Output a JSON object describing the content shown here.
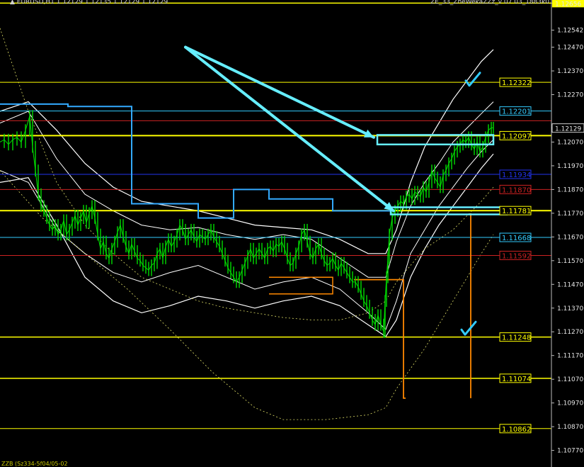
{
  "window": {
    "header_left": "▲ EURUSD,H1 1.12129 1.12135 1.12129 1.12129",
    "header_right": "ZE_33_ZheWekaZZz_v 07 03_1883k0",
    "footer_left": "ZZB (Sz334-5f04/05-02"
  },
  "colors": {
    "background": "#000000",
    "yellow_level": "#ffff00",
    "cyan_level": "#33ccff",
    "red_level": "#cc2222",
    "blue_level": "#2233ee",
    "candle_green": "#00dd00",
    "band_white": "#ffffff",
    "orange": "#ff8800",
    "arrow_cyan": "#66eeff",
    "checkmark": "#33ccff"
  },
  "chart_data": {
    "type": "line",
    "instrument": "EURUSD",
    "timeframe": "H1",
    "ylim": [
      1.107,
      1.1266
    ],
    "y_ticks": [
      "1.12656",
      "1.12542",
      "1.12470",
      "1.12370",
      "1.12270",
      "1.12129",
      "1.12070",
      "1.11970",
      "1.11870",
      "1.11770",
      "1.11670",
      "1.11570",
      "1.11470",
      "1.11370",
      "1.11270",
      "1.11170",
      "1.11070",
      "1.10970",
      "1.10870",
      "1.10770"
    ],
    "current_price": "1.12129",
    "price_levels": [
      {
        "name": "resistance-1",
        "value": 1.12322,
        "label": "1.12322",
        "color": "#ffff00",
        "style": "thin"
      },
      {
        "name": "resistance-2",
        "value": 1.12201,
        "label": "1.12201",
        "color": "#33ccff",
        "style": "thin"
      },
      {
        "name": "level-red-1",
        "value": 1.1216,
        "label": "",
        "color": "#cc2222",
        "style": "thin"
      },
      {
        "name": "level-yellow-main",
        "value": 1.12097,
        "label": "1.12097",
        "color": "#ffff00",
        "style": "thick"
      },
      {
        "name": "level-blue",
        "value": 1.11934,
        "label": "1.11934",
        "color": "#2233ee",
        "style": "thin"
      },
      {
        "name": "level-red-2",
        "value": 1.1187,
        "label": "1.11870",
        "color": "#cc2222",
        "style": "thin"
      },
      {
        "name": "level-yellow-2",
        "value": 1.11781,
        "label": "1.11781",
        "color": "#ffff00",
        "style": "thick"
      },
      {
        "name": "level-cyan-2",
        "value": 1.11668,
        "label": "1.11668",
        "color": "#33ccff",
        "style": "thin"
      },
      {
        "name": "level-red-3",
        "value": 1.11592,
        "label": "1.11592",
        "color": "#cc2222",
        "style": "thin"
      },
      {
        "name": "level-yellow-3",
        "value": 1.11248,
        "label": "1.11248",
        "color": "#ffff00",
        "style": "medium"
      },
      {
        "name": "level-yellow-4",
        "value": 1.11074,
        "label": "1.11074",
        "color": "#ffff00",
        "style": "medium"
      },
      {
        "name": "level-yellow-5",
        "value": 1.10862,
        "label": "1.10862",
        "color": "#ffff00",
        "style": "thin"
      }
    ],
    "top_level": {
      "value": 1.12656,
      "label": "1.12656"
    },
    "price_series": [
      [
        0,
        1.1207
      ],
      [
        6,
        1.1208
      ],
      [
        12,
        1.1206
      ],
      [
        18,
        1.1208
      ],
      [
        24,
        1.1209
      ],
      [
        30,
        1.1207
      ],
      [
        36,
        1.1212
      ],
      [
        42,
        1.1218
      ],
      [
        46,
        1.1205
      ],
      [
        50,
        1.1195
      ],
      [
        54,
        1.1185
      ],
      [
        58,
        1.118
      ],
      [
        62,
        1.1178
      ],
      [
        66,
        1.1175
      ],
      [
        70,
        1.1172
      ],
      [
        74,
        1.117
      ],
      [
        78,
        1.1172
      ],
      [
        82,
        1.1168
      ],
      [
        86,
        1.117
      ],
      [
        90,
        1.1174
      ],
      [
        94,
        1.1168
      ],
      [
        98,
        1.117
      ],
      [
        102,
        1.1173
      ],
      [
        106,
        1.1176
      ],
      [
        110,
        1.1172
      ],
      [
        114,
        1.1175
      ],
      [
        118,
        1.1178
      ],
      [
        122,
        1.1173
      ],
      [
        126,
        1.1177
      ],
      [
        130,
        1.118
      ],
      [
        134,
        1.1175
      ],
      [
        138,
        1.1168
      ],
      [
        142,
        1.1162
      ],
      [
        146,
        1.1165
      ],
      [
        150,
        1.116
      ],
      [
        154,
        1.1158
      ],
      [
        158,
        1.1162
      ],
      [
        162,
        1.1165
      ],
      [
        166,
        1.1169
      ],
      [
        170,
        1.1172
      ],
      [
        174,
        1.1167
      ],
      [
        178,
        1.1163
      ],
      [
        182,
        1.116
      ],
      [
        186,
        1.1164
      ],
      [
        190,
        1.1161
      ],
      [
        194,
        1.1158
      ],
      [
        198,
        1.1157
      ],
      [
        202,
        1.1155
      ],
      [
        206,
        1.1154
      ],
      [
        210,
        1.1153
      ],
      [
        214,
        1.1155
      ],
      [
        218,
        1.1156
      ],
      [
        222,
        1.116
      ],
      [
        226,
        1.1162
      ],
      [
        230,
        1.1158
      ],
      [
        234,
        1.1163
      ],
      [
        238,
        1.1166
      ],
      [
        242,
        1.1163
      ],
      [
        246,
        1.1165
      ],
      [
        250,
        1.1168
      ],
      [
        254,
        1.1172
      ],
      [
        258,
        1.117
      ],
      [
        262,
        1.1166
      ],
      [
        266,
        1.1168
      ],
      [
        270,
        1.117
      ],
      [
        274,
        1.1167
      ],
      [
        278,
        1.1165
      ],
      [
        282,
        1.1168
      ],
      [
        286,
        1.1167
      ],
      [
        290,
        1.1166
      ],
      [
        294,
        1.1168
      ],
      [
        298,
        1.117
      ],
      [
        302,
        1.1167
      ],
      [
        306,
        1.1165
      ],
      [
        310,
        1.1163
      ],
      [
        314,
        1.116
      ],
      [
        318,
        1.1157
      ],
      [
        322,
        1.1154
      ],
      [
        326,
        1.1152
      ],
      [
        330,
        1.115
      ],
      [
        334,
        1.1148
      ],
      [
        338,
        1.115
      ],
      [
        342,
        1.1153
      ],
      [
        346,
        1.1156
      ],
      [
        350,
        1.1159
      ],
      [
        354,
        1.1162
      ],
      [
        358,
        1.1158
      ],
      [
        362,
        1.116
      ],
      [
        366,
        1.1162
      ],
      [
        370,
        1.116
      ],
      [
        374,
        1.1158
      ],
      [
        378,
        1.1162
      ],
      [
        382,
        1.1163
      ],
      [
        386,
        1.1161
      ],
      [
        390,
        1.1164
      ],
      [
        394,
        1.1163
      ],
      [
        398,
        1.1165
      ],
      [
        402,
        1.1162
      ],
      [
        406,
        1.1158
      ],
      [
        410,
        1.1155
      ],
      [
        414,
        1.1156
      ],
      [
        418,
        1.116
      ],
      [
        422,
        1.1163
      ],
      [
        426,
        1.1168
      ],
      [
        430,
        1.117
      ],
      [
        434,
        1.1165
      ],
      [
        438,
        1.116
      ],
      [
        442,
        1.1158
      ],
      [
        446,
        1.1162
      ],
      [
        450,
        1.1164
      ],
      [
        454,
        1.116
      ],
      [
        458,
        1.1157
      ],
      [
        462,
        1.1155
      ],
      [
        466,
        1.1156
      ],
      [
        470,
        1.1158
      ],
      [
        474,
        1.1155
      ],
      [
        478,
        1.1153
      ],
      [
        482,
        1.1156
      ],
      [
        486,
        1.1154
      ],
      [
        490,
        1.1152
      ],
      [
        494,
        1.115
      ],
      [
        498,
        1.1148
      ],
      [
        502,
        1.1148
      ],
      [
        506,
        1.1146
      ],
      [
        510,
        1.1143
      ],
      [
        514,
        1.114
      ],
      [
        518,
        1.1138
      ],
      [
        522,
        1.1135
      ],
      [
        526,
        1.1132
      ],
      [
        530,
        1.113
      ],
      [
        534,
        1.1134
      ],
      [
        538,
        1.113
      ],
      [
        542,
        1.1127
      ],
      [
        544,
        1.114
      ],
      [
        546,
        1.115
      ],
      [
        548,
        1.1158
      ],
      [
        550,
        1.1168
      ],
      [
        554,
        1.1175
      ],
      [
        558,
        1.1178
      ],
      [
        562,
        1.118
      ],
      [
        566,
        1.1182
      ],
      [
        570,
        1.1181
      ],
      [
        574,
        1.1184
      ],
      [
        578,
        1.1185
      ],
      [
        582,
        1.1183
      ],
      [
        586,
        1.1186
      ],
      [
        590,
        1.1185
      ],
      [
        594,
        1.1184
      ],
      [
        598,
        1.1188
      ],
      [
        602,
        1.1186
      ],
      [
        606,
        1.119
      ],
      [
        610,
        1.1195
      ],
      [
        614,
        1.1192
      ],
      [
        618,
        1.119
      ],
      [
        622,
        1.1188
      ],
      [
        626,
        1.1193
      ],
      [
        630,
        1.1195
      ],
      [
        634,
        1.1198
      ],
      [
        638,
        1.12
      ],
      [
        642,
        1.1203
      ],
      [
        646,
        1.1205
      ],
      [
        650,
        1.1206
      ],
      [
        654,
        1.1208
      ],
      [
        658,
        1.1207
      ],
      [
        662,
        1.1209
      ],
      [
        666,
        1.1206
      ],
      [
        670,
        1.1204
      ],
      [
        674,
        1.1207
      ],
      [
        678,
        1.1203
      ],
      [
        682,
        1.1205
      ],
      [
        686,
        1.1209
      ],
      [
        690,
        1.1212
      ],
      [
        694,
        1.1213
      ],
      [
        697,
        1.1213
      ]
    ],
    "bands": {
      "upper_outer": [
        [
          0,
          1.122
        ],
        [
          40,
          1.1224
        ],
        [
          80,
          1.1212
        ],
        [
          120,
          1.1198
        ],
        [
          160,
          1.1188
        ],
        [
          200,
          1.1182
        ],
        [
          240,
          1.118
        ],
        [
          280,
          1.1178
        ],
        [
          320,
          1.1175
        ],
        [
          360,
          1.1172
        ],
        [
          400,
          1.1171
        ],
        [
          440,
          1.117
        ],
        [
          480,
          1.1166
        ],
        [
          520,
          1.116
        ],
        [
          545,
          1.116
        ],
        [
          560,
          1.117
        ],
        [
          580,
          1.119
        ],
        [
          600,
          1.1205
        ],
        [
          620,
          1.1215
        ],
        [
          640,
          1.1225
        ],
        [
          660,
          1.1233
        ],
        [
          680,
          1.1241
        ],
        [
          697,
          1.1246
        ]
      ],
      "upper_inner": [
        [
          0,
          1.1215
        ],
        [
          40,
          1.122
        ],
        [
          80,
          1.12
        ],
        [
          120,
          1.1185
        ],
        [
          160,
          1.1178
        ],
        [
          200,
          1.1172
        ],
        [
          240,
          1.117
        ],
        [
          280,
          1.1171
        ],
        [
          320,
          1.1168
        ],
        [
          360,
          1.1166
        ],
        [
          400,
          1.1168
        ],
        [
          440,
          1.1166
        ],
        [
          480,
          1.1158
        ],
        [
          520,
          1.115
        ],
        [
          545,
          1.115
        ],
        [
          560,
          1.1165
        ],
        [
          580,
          1.118
        ],
        [
          600,
          1.119
        ],
        [
          620,
          1.1198
        ],
        [
          640,
          1.1207
        ],
        [
          660,
          1.1213
        ],
        [
          680,
          1.1219
        ],
        [
          697,
          1.1224
        ]
      ],
      "lower_inner": [
        [
          0,
          1.1195
        ],
        [
          40,
          1.119
        ],
        [
          80,
          1.117
        ],
        [
          120,
          1.116
        ],
        [
          160,
          1.1152
        ],
        [
          200,
          1.1148
        ],
        [
          240,
          1.1152
        ],
        [
          280,
          1.1155
        ],
        [
          320,
          1.115
        ],
        [
          360,
          1.1145
        ],
        [
          400,
          1.1148
        ],
        [
          440,
          1.115
        ],
        [
          480,
          1.1145
        ],
        [
          520,
          1.1135
        ],
        [
          545,
          1.1128
        ],
        [
          560,
          1.114
        ],
        [
          580,
          1.116
        ],
        [
          600,
          1.117
        ],
        [
          620,
          1.118
        ],
        [
          640,
          1.1188
        ],
        [
          660,
          1.1196
        ],
        [
          680,
          1.1203
        ],
        [
          697,
          1.1208
        ]
      ],
      "lower_outer": [
        [
          0,
          1.119
        ],
        [
          40,
          1.1192
        ],
        [
          80,
          1.1172
        ],
        [
          120,
          1.115
        ],
        [
          160,
          1.114
        ],
        [
          200,
          1.1135
        ],
        [
          240,
          1.1138
        ],
        [
          280,
          1.1142
        ],
        [
          320,
          1.114
        ],
        [
          360,
          1.1137
        ],
        [
          400,
          1.114
        ],
        [
          440,
          1.1142
        ],
        [
          480,
          1.1138
        ],
        [
          520,
          1.113
        ],
        [
          545,
          1.1125
        ],
        [
          560,
          1.1132
        ],
        [
          580,
          1.115
        ],
        [
          600,
          1.1162
        ],
        [
          620,
          1.1172
        ],
        [
          640,
          1.118
        ],
        [
          660,
          1.1188
        ],
        [
          680,
          1.1196
        ],
        [
          697,
          1.1202
        ]
      ],
      "dashed_mid": [
        [
          0,
          1.1255
        ],
        [
          40,
          1.122
        ],
        [
          80,
          1.119
        ],
        [
          120,
          1.1172
        ],
        [
          160,
          1.116
        ],
        [
          200,
          1.115
        ],
        [
          240,
          1.1145
        ],
        [
          280,
          1.114
        ],
        [
          320,
          1.1137
        ],
        [
          360,
          1.1135
        ],
        [
          400,
          1.1133
        ],
        [
          440,
          1.1132
        ],
        [
          480,
          1.1132
        ],
        [
          520,
          1.1135
        ],
        [
          545,
          1.114
        ],
        [
          560,
          1.1148
        ],
        [
          600,
          1.1162
        ],
        [
          640,
          1.117
        ],
        [
          680,
          1.1182
        ],
        [
          697,
          1.1188
        ]
      ],
      "dashed_low": [
        [
          0,
          1.1195
        ],
        [
          60,
          1.1175
        ],
        [
          120,
          1.116
        ],
        [
          180,
          1.1145
        ],
        [
          240,
          1.1128
        ],
        [
          300,
          1.111
        ],
        [
          360,
          1.1095
        ],
        [
          400,
          1.109
        ],
        [
          460,
          1.109
        ],
        [
          520,
          1.1092
        ],
        [
          545,
          1.1095
        ],
        [
          560,
          1.1103
        ],
        [
          600,
          1.112
        ],
        [
          640,
          1.114
        ],
        [
          680,
          1.116
        ],
        [
          697,
          1.1168
        ]
      ]
    },
    "step_lines": {
      "cyan_upper": [
        [
          0,
          1.1223
        ],
        [
          96,
          1.1223
        ],
        [
          96,
          1.1222
        ],
        [
          186,
          1.1222
        ],
        [
          186,
          1.1181
        ],
        [
          280,
          1.1181
        ],
        [
          280,
          1.1175
        ],
        [
          330,
          1.1175
        ],
        [
          330,
          1.1187
        ],
        [
          380,
          1.1187
        ],
        [
          380,
          1.1183
        ],
        [
          470,
          1.1183
        ],
        [
          470,
          1.1178
        ],
        [
          557,
          1.1178
        ]
      ],
      "orange_right": [
        [
          500,
          1.1149
        ],
        [
          570,
          1.1149
        ],
        [
          570,
          1.1099
        ],
        [
          573,
          1.1099
        ]
      ],
      "orange_far": [
        [
          665,
          1.1177
        ],
        [
          665,
          1.1099
        ]
      ],
      "orange_mid": [
        [
          380,
          1.115
        ],
        [
          470,
          1.115
        ],
        [
          470,
          1.1143
        ],
        [
          380,
          1.1143
        ]
      ]
    },
    "annotations": {
      "arrow_1_from": [
        262,
        1.1247
      ],
      "arrow_1_to": [
        528,
        1.1209
      ],
      "arrow_2_from": [
        262,
        1.1247
      ],
      "arrow_2_to": [
        556,
        1.1178
      ],
      "box_upper": [
        533,
        1.121,
        697,
        1.1206
      ],
      "box_lower": [
        552,
        1.11795,
        716,
        1.11765
      ],
      "check_upper": [
        666,
        1.12335
      ],
      "check_lower": [
        660,
        1.11285
      ]
    }
  }
}
